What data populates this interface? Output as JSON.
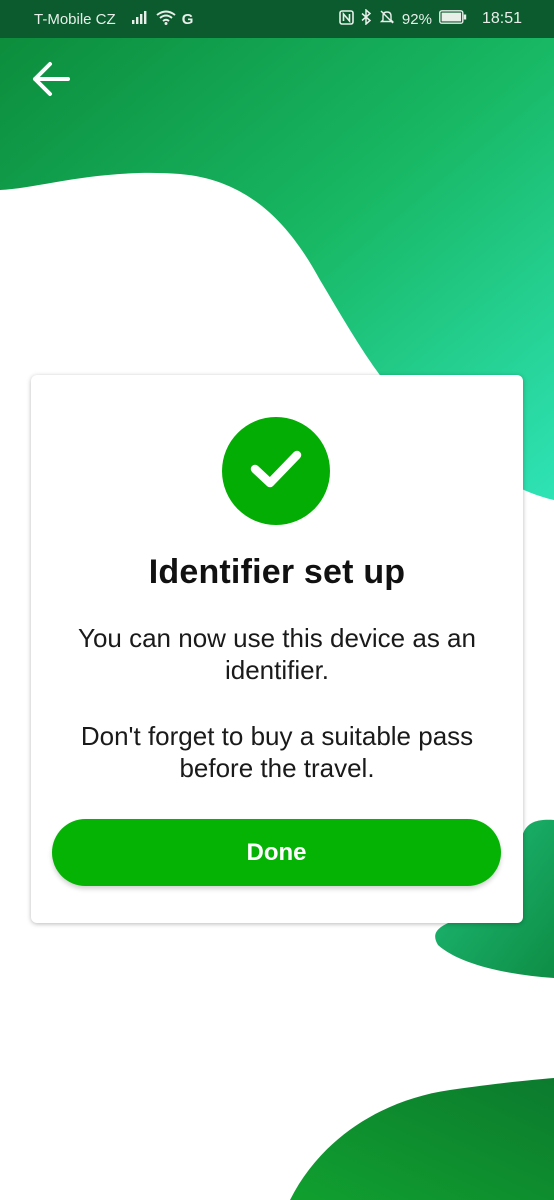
{
  "status_bar": {
    "carrier": "T-Mobile CZ",
    "network_letter": "G",
    "battery": "92%",
    "time": "18:51",
    "icons": [
      "signal-icon",
      "wifi-icon",
      "nfc-icon",
      "bluetooth-icon",
      "mute-icon",
      "battery-icon"
    ]
  },
  "header": {
    "back_icon": "back-arrow-icon"
  },
  "dialog": {
    "icon": "checkmark-icon",
    "title": "Identifier set up",
    "message_1": "You can now use this device as an identifier.",
    "message_2": "Don't forget to buy a suitable pass before the travel.",
    "done_label": "Done"
  },
  "colors": {
    "status_bar": "#0b5b2e",
    "accent_green": "#03ad03",
    "gradient_dark": "#0a8a3a",
    "gradient_light": "#2fe0b3",
    "card_bg": "#ffffff"
  }
}
